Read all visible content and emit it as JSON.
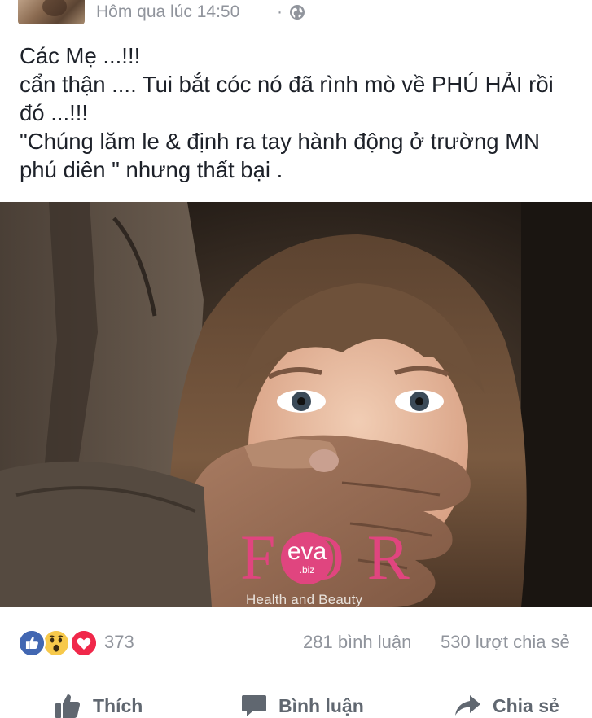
{
  "header": {
    "timestamp": "Hôm qua lúc 14:50",
    "separator": "·",
    "privacy_icon": "globe-icon"
  },
  "post": {
    "lines": [
      "Các Mẹ ...!!!",
      "cẩn thận .... Tui bắt cóc nó đã rình mò về PHÚ HẢI rồi",
      "đó ...!!!",
      "\"Chúng lăm le & định ra tay hành động ở trường MN",
      "phú diên \" nhưng thất bại ."
    ]
  },
  "photo": {
    "watermark_for": "FOR",
    "watermark_eva": "eva",
    "watermark_biz": ".biz",
    "watermark_tagline": "Health and Beauty"
  },
  "stats": {
    "reaction_icons": [
      "like-icon",
      "wow-icon",
      "love-icon"
    ],
    "reaction_count": "373",
    "comments": "281 bình luận",
    "shares": "530 lượt chia sẻ"
  },
  "actions": {
    "like_label": "Thích",
    "comment_label": "Bình luận",
    "share_label": "Chia sẻ"
  },
  "colors": {
    "secondary_text": "#90949c",
    "action_text": "#606770",
    "like_blue": "#4267b2",
    "love_red": "#f0284a",
    "wow_yellow": "#f7c94b",
    "watermark_pink": "#e0457f"
  }
}
